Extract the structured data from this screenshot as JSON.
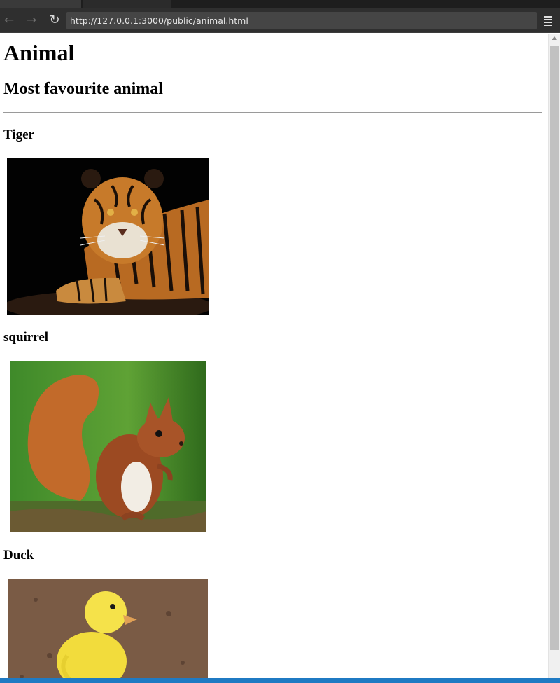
{
  "browser": {
    "url": "http://127.0.0.1:3000/public/animal.html",
    "back_icon": "arrow-left-icon",
    "forward_icon": "arrow-right-icon",
    "reload_icon": "reload-icon",
    "menu_icon": "hamburger-menu-icon"
  },
  "page": {
    "title": "Animal",
    "subtitle": "Most favourite animal",
    "animals": [
      {
        "name": "Tiger"
      },
      {
        "name": "squirrel"
      },
      {
        "name": "Duck"
      }
    ]
  },
  "colors": {
    "chrome_dark": "#2f2f2f",
    "urlbar_bg": "#454545",
    "status_blue": "#1f7ac3"
  }
}
